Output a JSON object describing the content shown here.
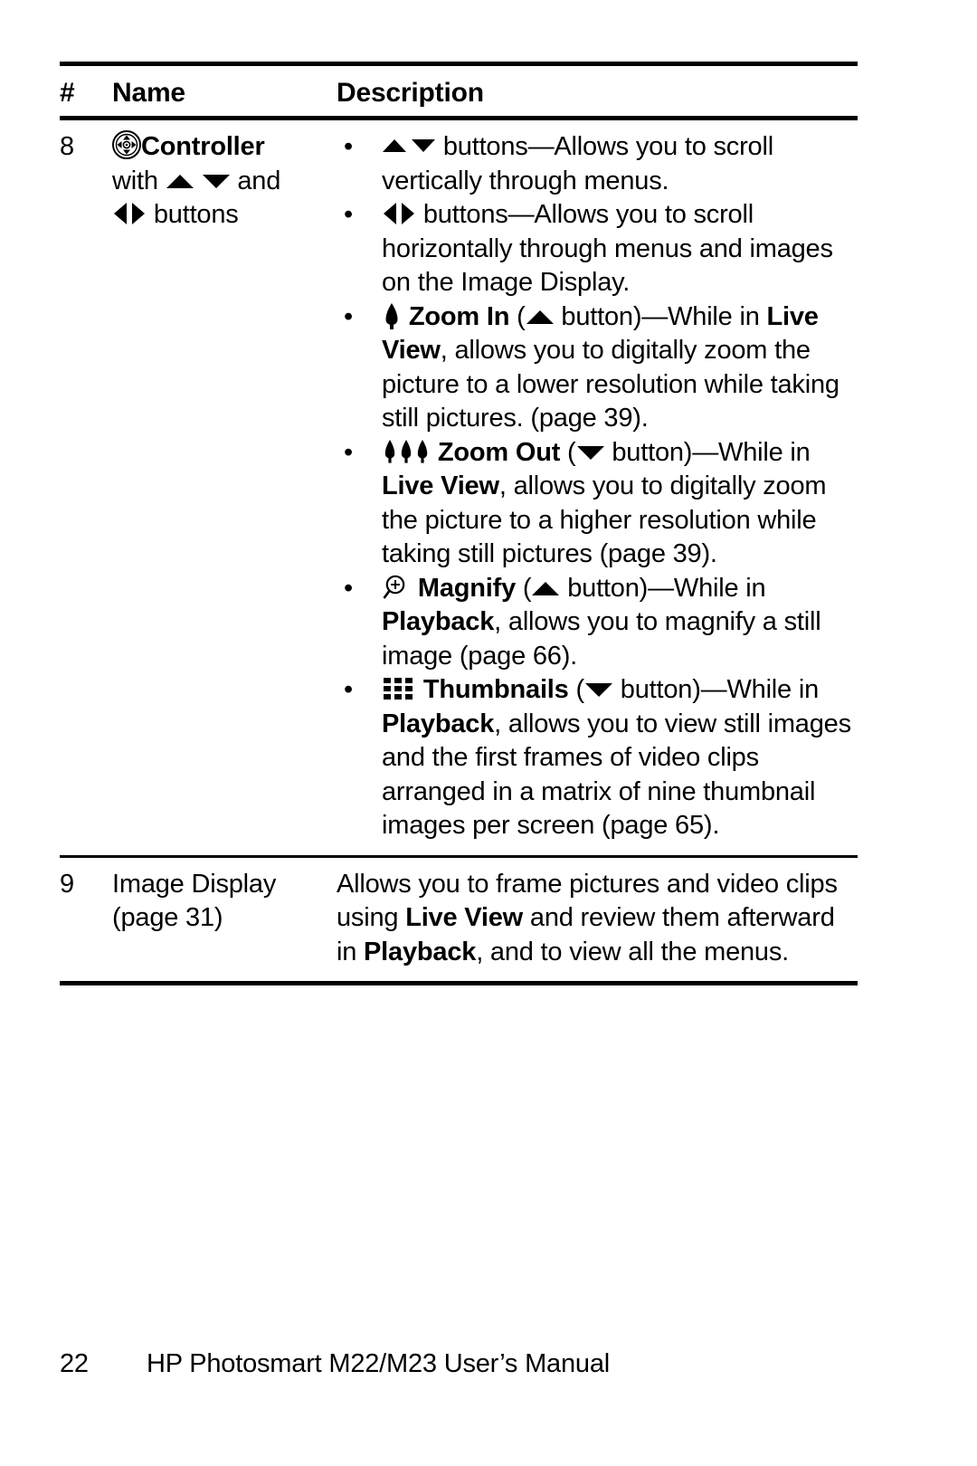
{
  "document": {
    "footer": {
      "page_number": "22",
      "title": "HP Photosmart M22/M23 User’s Manual"
    }
  },
  "table": {
    "headers": {
      "number": "#",
      "name": "Name",
      "description": "Description"
    },
    "rows": [
      {
        "number": "8",
        "name": {
          "icon": "controller-icon",
          "title": "Controller",
          "line2_prefix": "with ",
          "line2_icons": [
            "up-arrow-icon",
            "down-arrow-icon"
          ],
          "line2_suffix": " and",
          "line3_icons": [
            "left-arrow-icon",
            "right-arrow-icon"
          ],
          "line3_suffix": " buttons"
        },
        "description_bullets": [
          {
            "id": "updown-scroll",
            "lead_icon": "up-down-arrows-icon",
            "text": " buttons—Allows you to scroll vertically through menus."
          },
          {
            "id": "leftright-scroll",
            "lead_icon": "left-right-arrows-icon",
            "text": " buttons—Allows you to scroll horizontally through menus and images on the Image Display."
          },
          {
            "id": "zoom-in",
            "lead_icon": "single-tree-icon",
            "label": "Zoom In",
            "paren_open": " (",
            "paren_icon": "up-arrow-icon",
            "paren_close": " button)—While in ",
            "bold_mode": "Live View",
            "text": ", allows you to digitally zoom the picture to a lower resolution while taking still pictures. (page 39)."
          },
          {
            "id": "zoom-out",
            "lead_icon": "three-trees-icon",
            "label": "Zoom Out",
            "paren_open": " (",
            "paren_icon": "down-arrow-icon",
            "paren_close": " button)—While in ",
            "bold_mode": "Live View",
            "text": ", allows you to digitally zoom the picture to a higher resolution while taking still pictures (page 39)."
          },
          {
            "id": "magnify",
            "lead_icon": "magnify-icon",
            "label": "Magnify",
            "paren_open": " (",
            "paren_icon": "up-arrow-icon",
            "paren_close": " button)—While in ",
            "bold_mode": "Playback",
            "text": ", allows you to magnify a still image (page 66)."
          },
          {
            "id": "thumbnails",
            "lead_icon": "thumbnails-grid-icon",
            "label": "Thumbnails",
            "paren_open": " (",
            "paren_icon": "down-arrow-icon",
            "paren_close": " button)—While in ",
            "bold_mode": "Playback",
            "text": ", allows you to view still images and the first frames of video clips arranged in a matrix of nine thumbnail images per screen (page 65)."
          }
        ]
      },
      {
        "number": "9",
        "name": {
          "title_plain": "Image Display",
          "page_ref": "(page 31)"
        },
        "description_text": {
          "part1": "Allows you to frame pictures and video clips using ",
          "bold1": "Live View",
          "part2": " and review them afterward in ",
          "bold2": "Playback",
          "part3": ", and to view all the menus."
        }
      }
    ]
  },
  "colors": {
    "ink": "#000000",
    "paper": "#ffffff"
  }
}
